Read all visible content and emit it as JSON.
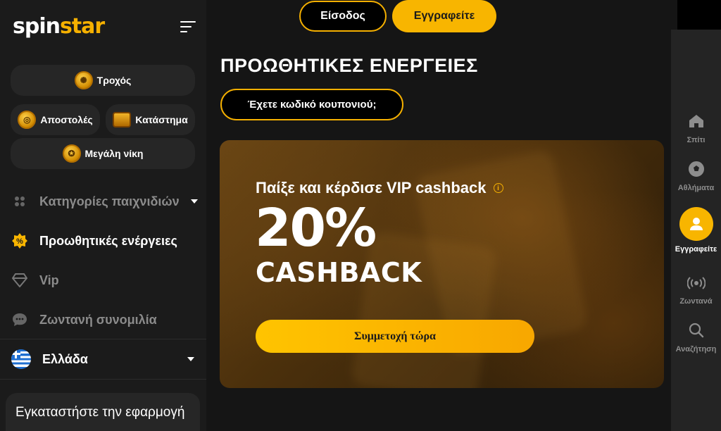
{
  "logo": {
    "part1": "spin",
    "part2": "star"
  },
  "header": {
    "login_label": "Είσοδος",
    "register_label": "Εγγραφείτε"
  },
  "sidebar": {
    "pills": {
      "wheel": "Τροχός",
      "missions": "Αποστολές",
      "shop": "Κατάστημα",
      "big_win": "Μεγάλη νίκη"
    },
    "nav": {
      "categories": "Κατηγορίες παιχνιδιών",
      "promotions": "Προωθητικές ενέργειες",
      "vip": "Vip",
      "chat": "Ζωντανή συνομιλία"
    },
    "language": "Ελλάδα",
    "install_card": "Εγκαταστήστε την εφαρμογή"
  },
  "main": {
    "title": "ΠΡΟΩΘΗΤΙΚΕΣ ΕΝΕΡΓΕΙΕΣ",
    "coupon_label": "Έχετε κωδικό κουπονιού;",
    "promo": {
      "subtitle": "Παίξε και κέρδισε VIP cashback",
      "percent": "20%",
      "word": "CASHBACK",
      "cta": "Συμμετοχή τώρα"
    }
  },
  "rail": {
    "home": "Σπίτι",
    "sports": "Αθλήματα",
    "register": "Εγγραφείτε",
    "live": "Ζωντανά",
    "search": "Αναζήτηση"
  },
  "colors": {
    "accent": "#f8b500",
    "sidebar": "#1b1b1b",
    "rail": "#242424"
  }
}
